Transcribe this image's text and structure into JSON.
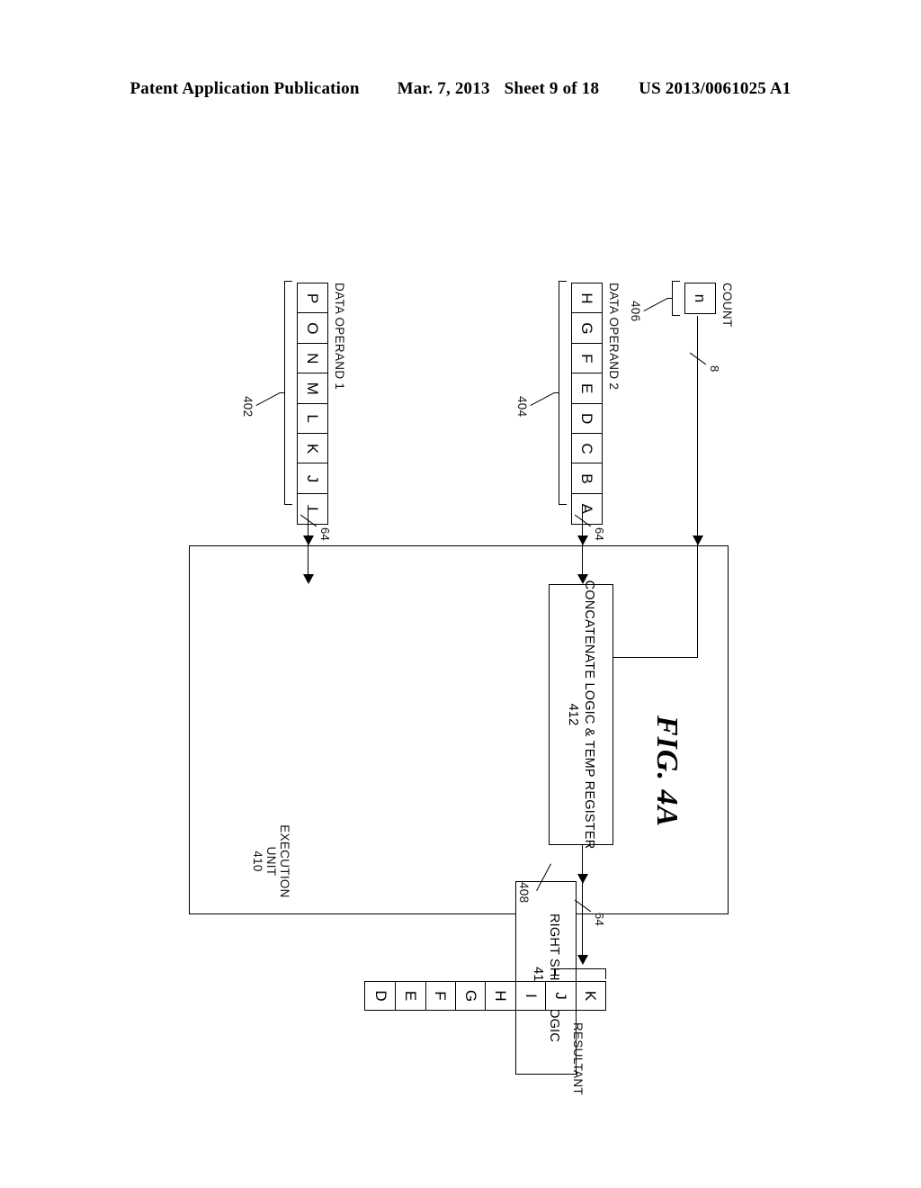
{
  "header": {
    "publication": "Patent Application Publication",
    "date": "Mar. 7, 2013",
    "sheet": "Sheet 9 of 18",
    "docnumber": "US 2013/0061025 A1"
  },
  "figure": {
    "title": "FIG. 4A",
    "count_register": {
      "label": "COUNT",
      "cells": [
        "n"
      ],
      "ref": "406",
      "bus_width": "8"
    },
    "data_operand_2": {
      "label": "DATA OPERAND 2",
      "cells": [
        "H",
        "G",
        "F",
        "E",
        "D",
        "C",
        "B",
        "A"
      ],
      "ref": "404",
      "bus_width": "64"
    },
    "data_operand_1": {
      "label": "DATA OPERAND 1",
      "cells": [
        "P",
        "O",
        "N",
        "M",
        "L",
        "K",
        "J",
        "I"
      ],
      "ref": "402",
      "bus_width": "64"
    },
    "execution_unit": {
      "line1": "EXECUTION",
      "line2": "UNIT",
      "ref": "410"
    },
    "concatenate_logic": {
      "line1": "CONCATENATE LOGIC & TEMP REGISTER",
      "ref": "412"
    },
    "right_shift_logic": {
      "line1": "RIGHT SHIFT LOGIC",
      "ref": "414"
    },
    "resultant": {
      "label": "RESULTANT",
      "cells": [
        "K",
        "J",
        "I",
        "H",
        "G",
        "F",
        "E",
        "D"
      ],
      "ref": "408",
      "bus_width": "64"
    }
  }
}
